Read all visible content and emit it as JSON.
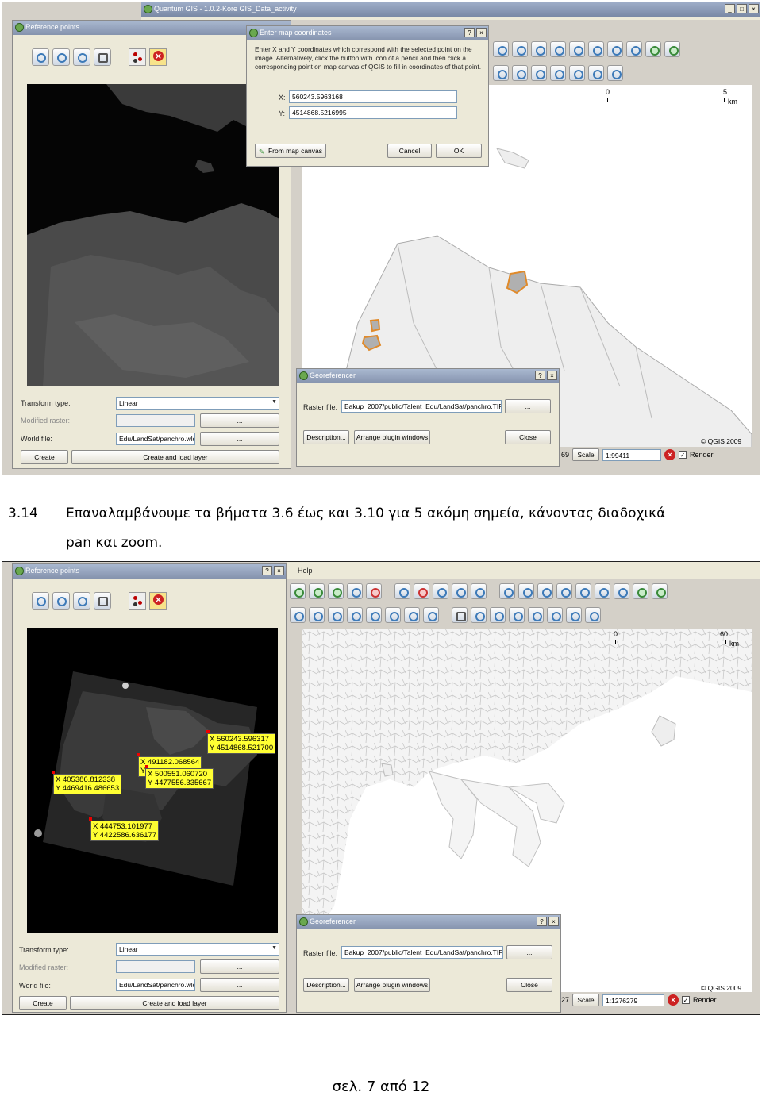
{
  "screenshot1": {
    "main_window": {
      "title": "Quantum GIS - 1.0.2-Kore  GIS_Data_activity"
    },
    "reference_points_panel": {
      "title": "Reference points"
    },
    "dialog": {
      "title": "Enter map coordinates",
      "instructions": "Enter X and Y coordinates which correspond with the selected point on the image. Alternatively, click the button with icon of a pencil and then click a corresponding point on map canvas of QGIS to fill in coordinates of that point.",
      "x_label": "X:",
      "x_value": "560243.5963168",
      "y_label": "Y:",
      "y_value": "4514868.5216995",
      "from_canvas_label": "From map canvas",
      "cancel_label": "Cancel",
      "ok_label": "OK"
    },
    "georeferencer": {
      "title": "Georeferencer",
      "raster_label": "Raster file:",
      "raster_value": "Bakup_2007/public/Talent_Edu/LandSat/panchro.TIF",
      "browse_label": "...",
      "description_label": "Description...",
      "arrange_label": "Arrange plugin windows",
      "close_label": "Close"
    },
    "bottom_panel": {
      "transform_label": "Transform type:",
      "transform_value": "Linear",
      "modified_label": "Modified raster:",
      "world_label": "World file:",
      "world_value": "Edu/LandSat/panchro.wld",
      "browse_label": "...",
      "create_label": "Create",
      "create_load_label": "Create and load layer"
    },
    "scalebar": {
      "left": "0",
      "right": "5",
      "unit": "km"
    },
    "credit": "© QGIS 2009",
    "status": {
      "coord_tail": "69",
      "scale_label": "Scale",
      "scale_value": "1:99411",
      "render_label": "Render"
    }
  },
  "caption": {
    "number": "3.14",
    "line1": "Επαναλαμβάνουμε τα βήματα 3.6 έως και 3.10 για 5 ακόμη σημεία, κάνοντας διαδοχικά",
    "line2": "pan και zoom."
  },
  "screenshot2": {
    "reference_points_panel": {
      "title": "Reference points"
    },
    "menu_help": "Help",
    "points": [
      {
        "x": "X 560243.596317",
        "y": "Y 4514868.521700"
      },
      {
        "x": "X 491182.068564",
        "y": "Y"
      },
      {
        "x": "X 500551.060720",
        "y": "Y 4477556.335667"
      },
      {
        "x": "X 405386.812338",
        "y": "Y 4469416.486653"
      },
      {
        "x": "X 444753.101977",
        "y": "Y 4422586.636177"
      }
    ],
    "georeferencer": {
      "title": "Georeferencer",
      "raster_label": "Raster file:",
      "raster_value": "Bakup_2007/public/Talent_Edu/LandSat/panchro.TIF",
      "browse_label": "...",
      "description_label": "Description...",
      "arrange_label": "Arrange plugin windows",
      "close_label": "Close"
    },
    "bottom_panel": {
      "transform_label": "Transform type:",
      "transform_value": "Linear",
      "modified_label": "Modified raster:",
      "world_label": "World file:",
      "world_value": "Edu/LandSat/panchro.wld",
      "browse_label": "...",
      "create_label": "Create",
      "create_load_label": "Create and load layer"
    },
    "scalebar": {
      "left": "0",
      "right": "60",
      "unit": "km"
    },
    "credit": "© QGIS 2009",
    "status": {
      "coord_tail": "27",
      "scale_label": "Scale",
      "scale_value": "1:1276279",
      "render_label": "Render"
    }
  },
  "footer": "σελ. 7 από 12"
}
